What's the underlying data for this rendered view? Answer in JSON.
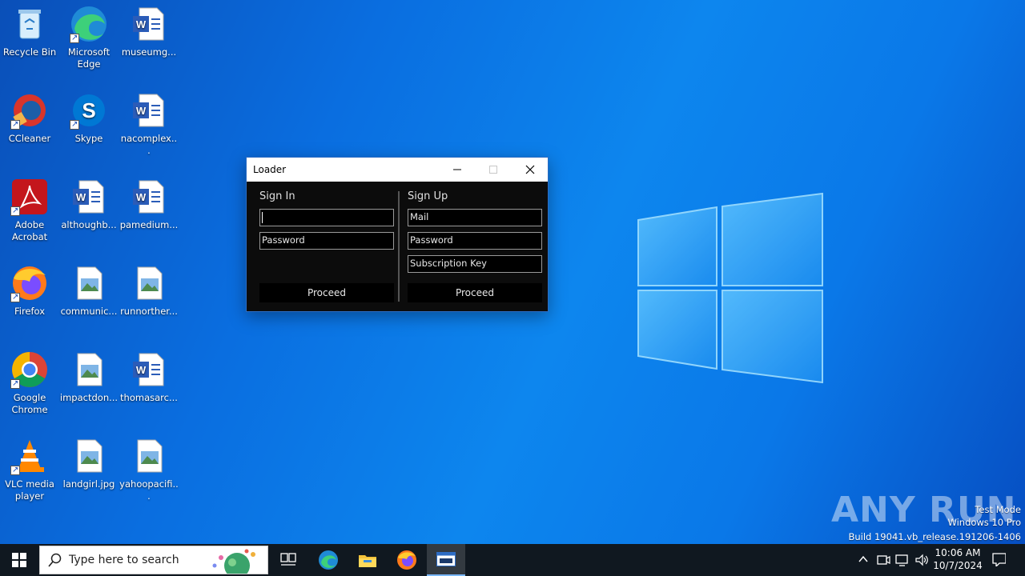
{
  "desktop": {
    "icons": [
      {
        "label": "Recycle Bin",
        "icon": "recycle-bin-icon"
      },
      {
        "label": "Microsoft Edge",
        "icon": "edge-icon"
      },
      {
        "label": "museumg...",
        "icon": "word-doc-icon"
      },
      {
        "label": "CCleaner",
        "icon": "ccleaner-icon"
      },
      {
        "label": "Skype",
        "icon": "skype-icon"
      },
      {
        "label": "nacomplex...",
        "icon": "word-doc-icon"
      },
      {
        "label": "Adobe Acrobat",
        "icon": "acrobat-icon"
      },
      {
        "label": "althoughb...",
        "icon": "word-doc-icon"
      },
      {
        "label": "pamedium...",
        "icon": "word-doc-icon"
      },
      {
        "label": "Firefox",
        "icon": "firefox-icon"
      },
      {
        "label": "communic...",
        "icon": "image-file-icon"
      },
      {
        "label": "runnorther...",
        "icon": "image-file-icon"
      },
      {
        "label": "Google Chrome",
        "icon": "chrome-icon"
      },
      {
        "label": "impactdon...",
        "icon": "image-file-icon"
      },
      {
        "label": "thomasarc...",
        "icon": "word-doc-icon"
      },
      {
        "label": "VLC media player",
        "icon": "vlc-icon"
      },
      {
        "label": "landgirl.jpg",
        "icon": "image-file-icon"
      },
      {
        "label": "yahoopacifi...",
        "icon": "image-file-icon"
      }
    ]
  },
  "loader": {
    "title": "Loader",
    "sign_in": {
      "heading": "Sign In",
      "username_value": "",
      "password_placeholder": "Password",
      "proceed_label": "Proceed"
    },
    "sign_up": {
      "heading": "Sign Up",
      "mail_placeholder": "Mail",
      "password_placeholder": "Password",
      "key_placeholder": "Subscription Key",
      "proceed_label": "Proceed"
    }
  },
  "watermark": {
    "brand": "ANY RUN",
    "test_mode": "Test Mode",
    "edition": "Windows 10 Pro",
    "build": "Build 19041.vb_release.191206-1406"
  },
  "taskbar": {
    "search_placeholder": "Type here to search",
    "apps": [
      "task-view-icon",
      "edge-icon",
      "file-explorer-icon",
      "firefox-icon",
      "loader-app-icon"
    ],
    "clock_time": "10:06 AM",
    "clock_date": "10/7/2024"
  },
  "colors": {
    "accent": "#0a78e8",
    "taskbar": "#101820",
    "window_bg": "#0c0c0c"
  }
}
